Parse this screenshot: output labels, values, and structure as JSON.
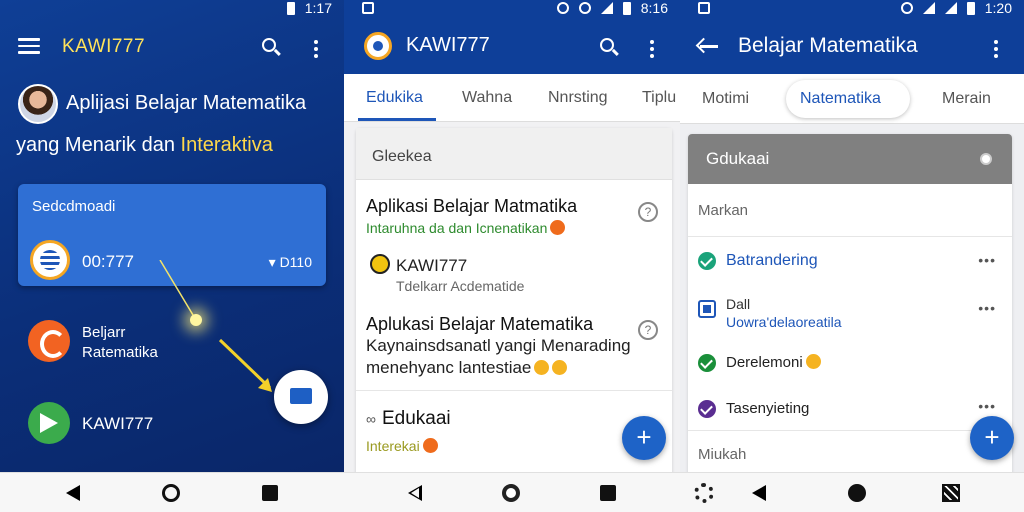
{
  "panel1": {
    "status": {
      "time": "1:17"
    },
    "app_title": "KAWI777",
    "hero_line1": "Aplijasi Belajar Matematika",
    "hero_line2_a": "yang Menarik dan",
    "hero_line2_b": "Interaktiva",
    "card": {
      "label": "Sedcdmoadi",
      "number": "00:777",
      "right_text": "D110"
    },
    "items": [
      {
        "label_line1": "Beljarr",
        "label_line2": "Ratematika",
        "icon": "orange-app-icon"
      },
      {
        "label_line1": "KAWI777",
        "icon": "green-play-icon"
      }
    ]
  },
  "panel2": {
    "status": {
      "time": "8:16"
    },
    "app_title": "KAWI777",
    "tabs": [
      "Edukika",
      "Wahna",
      "Nnrsting",
      "Tiplu"
    ],
    "card_header": "Gleekea",
    "entries": [
      {
        "title": "Aplikasi Belajar Matmatika",
        "subtitle": "Intaruhna da dan Icnenatikan"
      },
      {
        "title": "KAWI777",
        "subtitle": "Tdelkarr Acdematide"
      },
      {
        "title": "Aplukasi Belajar Matematika",
        "line2": "Kaynainsdsanatl yangi Menarading",
        "line3": "menehyanc lantestiae"
      },
      {
        "title": "Edukaai",
        "subtitle": "Interekai"
      }
    ],
    "fab_label": "+"
  },
  "panel3": {
    "status": {
      "time": "1:20"
    },
    "app_title": "Belajar Matematika",
    "tabs": [
      "Motimi",
      "Natematika",
      "Merain"
    ],
    "card_header": "Gdukaai",
    "section_label": "Markan",
    "rows": [
      {
        "title": "Batrandering",
        "color": "#1a8f3a"
      },
      {
        "title": "Dall",
        "subtitle": "Uowra'delaoreatila"
      },
      {
        "title": "Derelemoni",
        "color": "#1a8f3a"
      },
      {
        "title": "Tasenyieting",
        "color": "#5a2d91"
      }
    ],
    "footer_label": "Miukah",
    "fab_label": "+"
  },
  "colors": {
    "primary": "#0e3f99",
    "accent_yellow": "#ffe25a",
    "fab_blue": "#1e63c7"
  }
}
